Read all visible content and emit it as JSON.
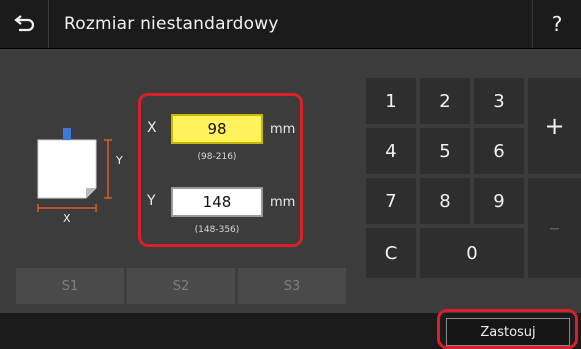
{
  "header": {
    "back_icon": "back-arrow-icon",
    "title": "Rozmiar niestandardowy",
    "help_label": "?"
  },
  "illustration": {
    "x_label": "X",
    "y_label": "Y",
    "arrow_color": "#3a7ad6"
  },
  "fields": {
    "x": {
      "label": "X",
      "value": "98",
      "unit": "mm",
      "range": "(98-216)"
    },
    "y": {
      "label": "Y",
      "value": "148",
      "unit": "mm",
      "range": "(148-356)"
    }
  },
  "presets": [
    "S1",
    "S2",
    "S3"
  ],
  "keypad": {
    "k1": "1",
    "k2": "2",
    "k3": "3",
    "k4": "4",
    "k5": "5",
    "k6": "6",
    "k7": "7",
    "k8": "8",
    "k9": "9",
    "clear": "C",
    "zero": "0",
    "plus": "+",
    "minus": "–"
  },
  "footer": {
    "apply_label": "Zastosuj"
  },
  "colors": {
    "highlight": "#d8202a",
    "active_field": "#fff25a"
  }
}
